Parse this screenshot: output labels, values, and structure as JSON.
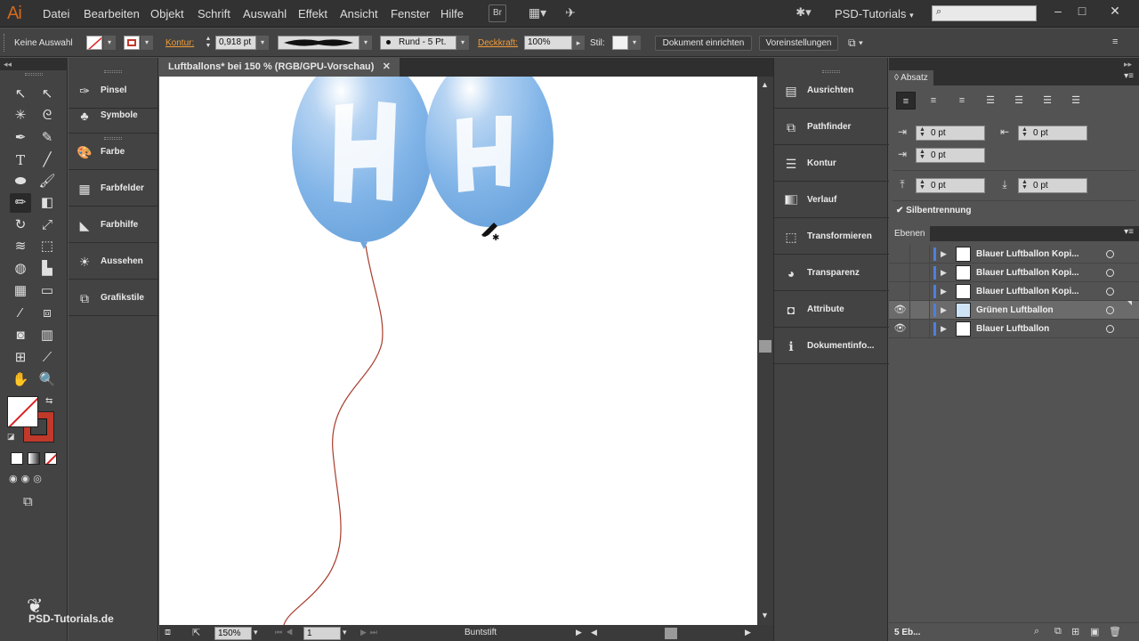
{
  "app": {
    "logo": "Ai",
    "menu": [
      "Datei",
      "Bearbeiten",
      "Objekt",
      "Schrift",
      "Auswahl",
      "Effekt",
      "Ansicht",
      "Fenster",
      "Hilfe"
    ],
    "bridge_label": "Br",
    "workspace": "PSD-Tutorials",
    "window_controls": [
      "–",
      "□",
      "✕"
    ]
  },
  "control_bar": {
    "selection": "Keine Auswahl",
    "stroke_label": "Kontur:",
    "stroke_weight": "0,918 pt",
    "brush_label": "Rund - 5 Pt.",
    "opacity_label": "Deckkraft:",
    "opacity_value": "100%",
    "style_label": "Stil:",
    "doc_setup_button": "Dokument einrichten",
    "preferences_button": "Voreinstellungen"
  },
  "left_panels": [
    {
      "label": "Pinsel",
      "icon": "brush-icon"
    },
    {
      "label": "Symbole",
      "icon": "club-icon"
    },
    {
      "label": "Farbe",
      "icon": "palette-icon"
    },
    {
      "label": "Farbfelder",
      "icon": "swatches-icon"
    },
    {
      "label": "Farbhilfe",
      "icon": "color-guide-icon"
    },
    {
      "label": "Aussehen",
      "icon": "appearance-icon"
    },
    {
      "label": "Grafikstile",
      "icon": "graphic-styles-icon"
    }
  ],
  "document": {
    "tab_title": "Luftballons* bei 150 % (RGB/GPU-Vorschau)",
    "zoom": "150%",
    "artboard": "1",
    "status_tool": "Buntstift"
  },
  "mid_panels": [
    {
      "label": "Ausrichten",
      "icon": "align-icon"
    },
    {
      "label": "Pathfinder",
      "icon": "pathfinder-icon"
    },
    {
      "label": "Kontur",
      "icon": "stroke-icon"
    },
    {
      "label": "Verlauf",
      "icon": "gradient-icon"
    },
    {
      "label": "Transformieren",
      "icon": "transform-icon"
    },
    {
      "label": "Transparenz",
      "icon": "transparency-icon"
    },
    {
      "label": "Attribute",
      "icon": "attributes-icon"
    },
    {
      "label": "Dokumentinfo...",
      "icon": "document-info-icon"
    }
  ],
  "paragraph_panel": {
    "tab": "Absatz",
    "left_indent": "0 pt",
    "right_indent": "0 pt",
    "first_line_indent": "0 pt",
    "space_before": "0 pt",
    "space_after": "0 pt",
    "hyphenation_label": "Silbentrennung",
    "hyphenation_checked": true
  },
  "layers_panel": {
    "tab": "Ebenen",
    "layers": [
      {
        "name": "Blauer Luftballon Kopi...",
        "visible": false,
        "selected": false
      },
      {
        "name": "Blauer Luftballon Kopi...",
        "visible": false,
        "selected": false
      },
      {
        "name": "Blauer Luftballon Kopi...",
        "visible": false,
        "selected": false
      },
      {
        "name": "Grünen Luftballon",
        "visible": true,
        "selected": true
      },
      {
        "name": "Blauer Luftballon",
        "visible": true,
        "selected": false
      }
    ],
    "count_label": "5 Eb..."
  },
  "watermark": "PSD-Tutorials.de",
  "colors": {
    "balloon": "#7fb3e6",
    "string": "#a83c2c",
    "accent_orange": "#f29d38",
    "layer_color": "#4f7fde"
  }
}
